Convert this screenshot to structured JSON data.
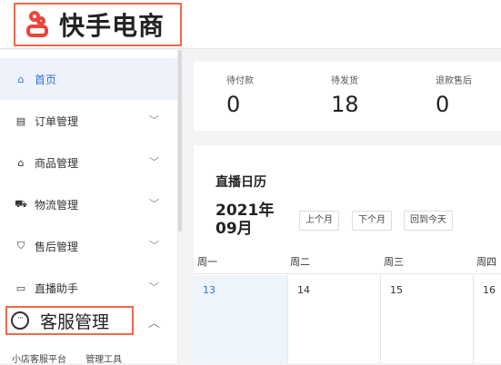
{
  "header": {
    "logo_text": "快手电商"
  },
  "sidebar": {
    "items": [
      {
        "label": "首页",
        "icon": "home-icon",
        "glyph": "⌂"
      },
      {
        "label": "订单管理",
        "icon": "order-icon",
        "glyph": "▤"
      },
      {
        "label": "商品管理",
        "icon": "goods-icon",
        "glyph": "⌂"
      },
      {
        "label": "物流管理",
        "icon": "truck-icon",
        "glyph": "⛟"
      },
      {
        "label": "售后管理",
        "icon": "shield-icon",
        "glyph": "⛉"
      },
      {
        "label": "直播助手",
        "icon": "live-icon",
        "glyph": "▭"
      }
    ],
    "customer_service": {
      "label": "客服管理",
      "icon": "chat-bubble-icon",
      "glyph": "···"
    },
    "sub_links": [
      "小店客服平台",
      "管理工具"
    ]
  },
  "stats": [
    {
      "label": "待付款",
      "value": "0"
    },
    {
      "label": "待发货",
      "value": "18"
    },
    {
      "label": "退款售后",
      "value": "0"
    }
  ],
  "calendar": {
    "title": "直播日历",
    "date_line1": "2021年",
    "date_line2": "09月",
    "buttons": [
      "上个月",
      "下个月",
      "回到今天"
    ],
    "weekdays": [
      "周一",
      "周二",
      "周三",
      "周四"
    ],
    "days": [
      "13",
      "14",
      "15",
      "16"
    ]
  },
  "colors": {
    "accent": "#2f6fe0",
    "highlight_border": "#f0694a",
    "logo": "#f0433a"
  }
}
